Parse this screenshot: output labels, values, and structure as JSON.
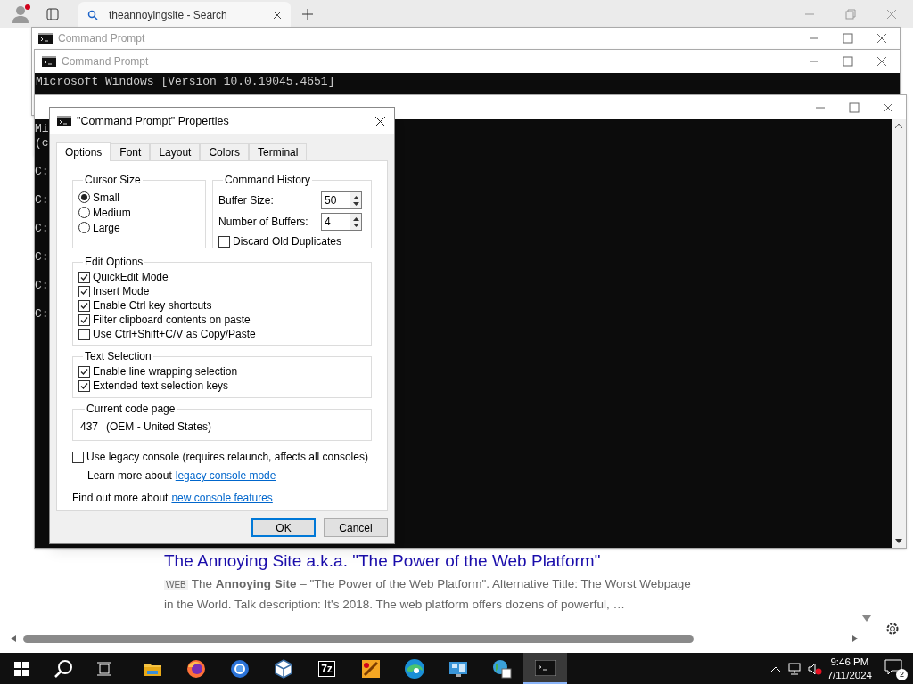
{
  "browser": {
    "tab": {
      "title": "theannoyingsite - Search"
    },
    "result": {
      "title": "The Annoying Site a.k.a. \"The Power of the Web Platform\"",
      "badge": "WEB",
      "snippet": "The **Annoying Site** – \"The Power of the Web Platform\". Alternative Title: The Worst Webpage in the World. Talk description: It's 2018. The web platform offers dozens of powerful, …"
    }
  },
  "consoles": [
    {
      "title": "Command Prompt"
    },
    {
      "title": "Command Prompt",
      "lines": [
        "Microsoft Windows [Version 10.0.19045.4651]"
      ]
    },
    {
      "lines": [
        "Mi",
        "(c"
      ],
      "prompts": [
        "C:",
        "C:",
        "C:",
        "C:",
        "C:",
        "C:"
      ]
    }
  ],
  "dialog": {
    "title": "\"Command Prompt\" Properties",
    "tabs": [
      {
        "label": "Options",
        "selected": true
      },
      {
        "label": "Font",
        "selected": false
      },
      {
        "label": "Layout",
        "selected": false
      },
      {
        "label": "Colors",
        "selected": false
      },
      {
        "label": "Terminal",
        "selected": false
      }
    ],
    "cursor_size": {
      "label": "Cursor Size",
      "options": [
        {
          "label": "Small",
          "selected": true
        },
        {
          "label": "Medium",
          "selected": false
        },
        {
          "label": "Large",
          "selected": false
        }
      ]
    },
    "command_history": {
      "label": "Command History",
      "spinners": [
        {
          "label": "Buffer Size:",
          "value": "50"
        },
        {
          "label": "Number of Buffers:",
          "value": "4"
        }
      ],
      "discard": {
        "label": "Discard Old Duplicates",
        "checked": false
      }
    },
    "edit_options": {
      "label": "Edit Options",
      "items": [
        {
          "label": "QuickEdit Mode",
          "checked": true
        },
        {
          "label": "Insert Mode",
          "checked": true
        },
        {
          "label": "Enable Ctrl key shortcuts",
          "checked": true
        },
        {
          "label": "Filter clipboard contents on paste",
          "checked": true
        },
        {
          "label": "Use Ctrl+Shift+C/V as Copy/Paste",
          "checked": false
        }
      ]
    },
    "text_selection": {
      "label": "Text Selection",
      "items": [
        {
          "label": "Enable line wrapping selection",
          "checked": true
        },
        {
          "label": "Extended text selection keys",
          "checked": true
        }
      ]
    },
    "code_page": {
      "label": "Current code page",
      "number": "437",
      "name": "(OEM - United States)"
    },
    "legacy": {
      "label": "Use legacy console (requires relaunch, affects all consoles)",
      "checked": false
    },
    "learn_more": {
      "text": "Learn more about",
      "link": "legacy console mode"
    },
    "find_out": {
      "text": "Find out more about",
      "link": "new console features"
    },
    "buttons": [
      {
        "label": "OK",
        "default": true
      },
      {
        "label": "Cancel",
        "default": false
      }
    ]
  },
  "taskbar": {
    "apps": [
      {
        "kind": "explorer",
        "active": false
      },
      {
        "kind": "firefox",
        "active": false
      },
      {
        "kind": "ring",
        "active": false
      },
      {
        "kind": "cube",
        "active": false
      },
      {
        "kind": "archiver",
        "label": "7z",
        "active": false
      },
      {
        "kind": "paint",
        "active": false
      },
      {
        "kind": "edge",
        "active": false
      },
      {
        "kind": "monitor",
        "active": false
      },
      {
        "kind": "globe",
        "active": false
      },
      {
        "kind": "terminal",
        "active": true
      }
    ],
    "time": "9:46 PM",
    "date": "7/11/2024",
    "notifications": "2"
  }
}
